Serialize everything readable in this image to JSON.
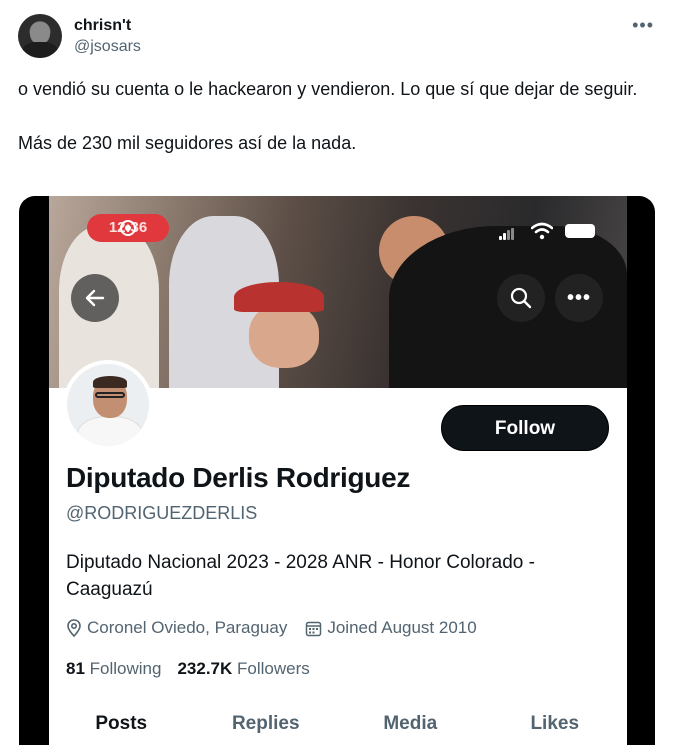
{
  "tweet": {
    "author_name": "chrisn't",
    "author_handle": "@jsosars",
    "more_icon": "more-horizontal-icon",
    "text_line1": "o vendió su cuenta o le hackearon y vendieron. Lo que sí que dejar de seguir.",
    "text_line2": "Más de 230 mil seguidores así de la nada."
  },
  "screenshot": {
    "status_bar": {
      "time": "12:36",
      "icons": [
        "signal-icon",
        "wifi-icon",
        "battery-icon"
      ]
    },
    "header_buttons": [
      "back-arrow-icon",
      "search-icon",
      "more-icon"
    ],
    "profile": {
      "name": "Diputado Derlis Rodriguez",
      "handle": "@RODRIGUEZDERLIS",
      "bio": "Diputado Nacional 2023 - 2028 ANR - Honor Colorado - Caaguazú",
      "location": "Coronel Oviedo, Paraguay",
      "joined": "Joined August 2010",
      "following_count": "81",
      "following_label": "Following",
      "followers_count": "232.7K",
      "followers_label": "Followers",
      "follow_button": "Follow"
    },
    "tabs": [
      {
        "label": "Posts",
        "active": true
      },
      {
        "label": "Replies",
        "active": false
      },
      {
        "label": "Media",
        "active": false
      },
      {
        "label": "Likes",
        "active": false
      }
    ]
  },
  "colors": {
    "text_primary": "#0f1419",
    "text_secondary": "#536471",
    "follow_button_bg": "#0f1419",
    "recording_pill": "#e0383c"
  }
}
